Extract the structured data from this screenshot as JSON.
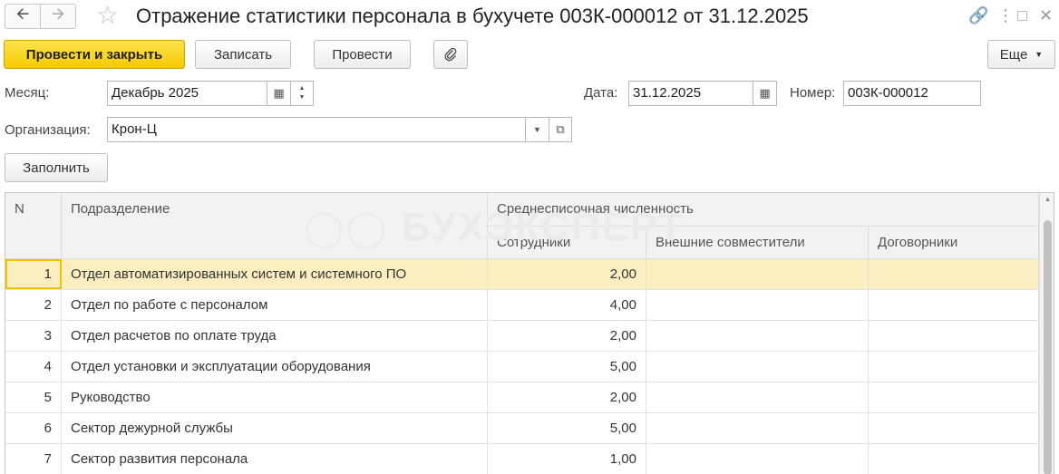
{
  "window": {
    "title": "Отражение статистики персонала в бухучете 003К-000012 от 31.12.2025",
    "icons": [
      "back-arrow-icon",
      "forward-arrow-icon",
      "favorite-star-icon",
      "link-icon",
      "more-vertical-icon",
      "maximize-icon",
      "close-icon"
    ]
  },
  "toolbar": {
    "post_close_label": "Провести и закрыть",
    "save_label": "Записать",
    "post_label": "Провести",
    "more_label": "Еще"
  },
  "form": {
    "month_label": "Месяц:",
    "month_value": "Декабрь 2025",
    "date_label": "Дата:",
    "date_value": "31.12.2025",
    "number_label": "Номер:",
    "number_value": "003К-000012",
    "org_label": "Организация:",
    "org_value": "Крон-Ц",
    "fill_label": "Заполнить"
  },
  "table": {
    "columns": {
      "n": "N",
      "department": "Подразделение",
      "avg_headcount": "Среднесписочная численность",
      "employees": "Сотрудники",
      "external": "Внешние совместители",
      "contractors": "Договорники"
    },
    "rows": [
      {
        "n": "1",
        "department": "Отдел автоматизированных систем и системного ПО",
        "employees": "2,00",
        "external": "",
        "contractors": ""
      },
      {
        "n": "2",
        "department": "Отдел по работе с персоналом",
        "employees": "4,00",
        "external": "",
        "contractors": ""
      },
      {
        "n": "3",
        "department": "Отдел расчетов по оплате труда",
        "employees": "2,00",
        "external": "",
        "contractors": ""
      },
      {
        "n": "4",
        "department": "Отдел установки и эксплуатации оборудования",
        "employees": "5,00",
        "external": "",
        "contractors": ""
      },
      {
        "n": "5",
        "department": "Руководство",
        "employees": "2,00",
        "external": "",
        "contractors": ""
      },
      {
        "n": "6",
        "department": "Сектор дежурной службы",
        "employees": "5,00",
        "external": "",
        "contractors": ""
      },
      {
        "n": "7",
        "department": "Сектор развития персонала",
        "employees": "1,00",
        "external": "",
        "contractors": ""
      }
    ]
  },
  "watermark": "БУХЭКСПЕРТ",
  "colors": {
    "accent": "#f5c900",
    "selection": "#fbeec0"
  }
}
